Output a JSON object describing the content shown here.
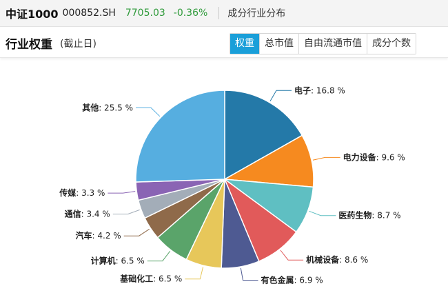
{
  "header": {
    "index_name": "中证1000",
    "index_code": "000852.SH",
    "price": "7705.03",
    "change_pct": "-0.36%",
    "section_title": "成分行业分布"
  },
  "panel": {
    "title": "行业权重",
    "subtitle": "(截止日)",
    "tabs": [
      "权重",
      "总市值",
      "自由流通市值",
      "成分个数"
    ],
    "active_tab": "权重"
  },
  "colors": {
    "accent": "#1a9fd9",
    "change": "#2e9a3a"
  },
  "chart_data": {
    "type": "pie",
    "unit": "%",
    "slices": [
      {
        "label": "电子",
        "value": 16.8,
        "color": "#2479a8"
      },
      {
        "label": "电力设备",
        "value": 9.6,
        "color": "#f68a1f"
      },
      {
        "label": "医药生物",
        "value": 8.7,
        "color": "#5fbfc2"
      },
      {
        "label": "机械设备",
        "value": 8.6,
        "color": "#e15a5a"
      },
      {
        "label": "有色金属",
        "value": 6.9,
        "color": "#4e5a92"
      },
      {
        "label": "基础化工",
        "value": 6.5,
        "color": "#e7c75a"
      },
      {
        "label": "计算机",
        "value": 6.5,
        "color": "#5aa46a"
      },
      {
        "label": "汽车",
        "value": 4.2,
        "color": "#8f6a4a"
      },
      {
        "label": "通信",
        "value": 3.4,
        "color": "#a3adb8"
      },
      {
        "label": "传媒",
        "value": 3.3,
        "color": "#8a64b4"
      },
      {
        "label": "其他",
        "value": 25.5,
        "color": "#56aee0"
      }
    ]
  }
}
